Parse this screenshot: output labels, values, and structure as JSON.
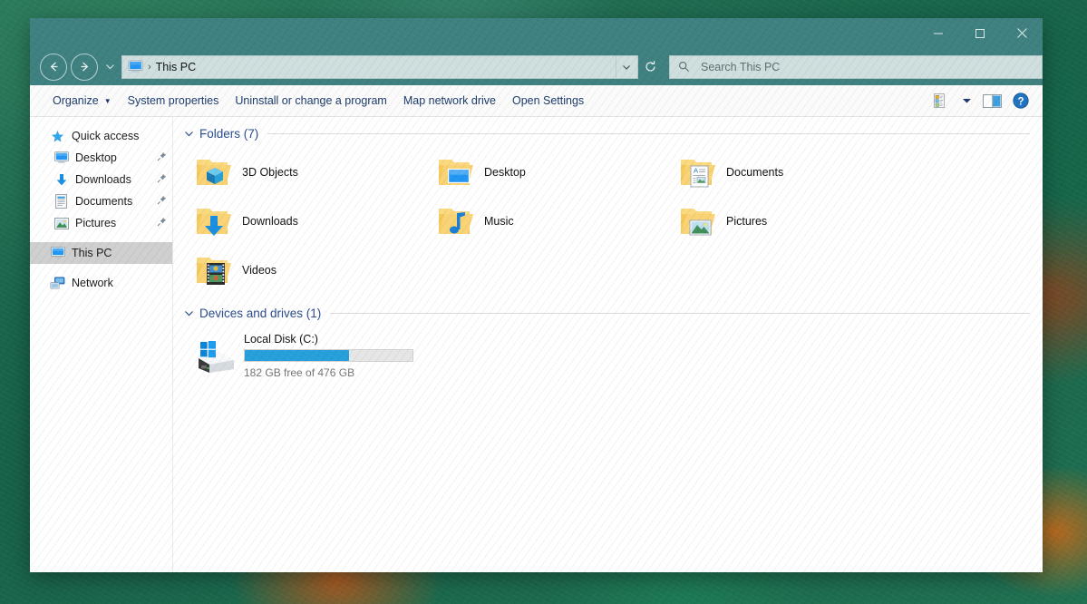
{
  "window": {
    "titlebar_color": "#3f8080",
    "controls": [
      {
        "name": "minimize",
        "glyph": "minimize-icon"
      },
      {
        "name": "maximize",
        "glyph": "maximize-icon"
      },
      {
        "name": "close",
        "glyph": "close-icon"
      }
    ]
  },
  "navigation": {
    "back_label": "Back",
    "forward_label": "Forward",
    "recent_label": "Recent locations",
    "refresh_label": "Refresh"
  },
  "address": {
    "icon": "this-pc-icon",
    "separator": "›",
    "path": "This PC",
    "dropdown": "chevron-down-icon"
  },
  "search": {
    "icon": "search-icon",
    "placeholder": "Search This PC"
  },
  "toolbar": {
    "items": [
      {
        "label": "Organize",
        "has_caret": true
      },
      {
        "label": "System properties",
        "has_caret": false
      },
      {
        "label": "Uninstall or change a program",
        "has_caret": false
      },
      {
        "label": "Map network drive",
        "has_caret": false
      },
      {
        "label": "Open Settings",
        "has_caret": false
      }
    ],
    "caret": "▼",
    "view_icon": "view-options-icon",
    "view_caret": "chevron-down-icon",
    "pane_icon": "preview-pane-icon",
    "help_icon": "help-icon"
  },
  "sidebar": {
    "items": [
      {
        "label": "Quick access",
        "icon": "star-icon",
        "pinned": false,
        "selected": false,
        "indent": false
      },
      {
        "label": "Desktop",
        "icon": "desktop-icon",
        "pinned": true,
        "selected": false,
        "indent": true
      },
      {
        "label": "Downloads",
        "icon": "downloads-icon",
        "pinned": true,
        "selected": false,
        "indent": true
      },
      {
        "label": "Documents",
        "icon": "documents-icon",
        "pinned": true,
        "selected": false,
        "indent": true
      },
      {
        "label": "Pictures",
        "icon": "pictures-icon",
        "pinned": true,
        "selected": false,
        "indent": true
      },
      {
        "label": "This PC",
        "icon": "this-pc-icon",
        "pinned": false,
        "selected": true,
        "indent": false
      },
      {
        "label": "Network",
        "icon": "network-icon",
        "pinned": false,
        "selected": false,
        "indent": false
      }
    ],
    "pin_glyph": "pin-icon"
  },
  "content": {
    "folders_group": {
      "title": "Folders (7)",
      "chevron": "chevron-down-icon",
      "items": [
        {
          "label": "3D Objects",
          "icon": "folder-3d-objects-icon"
        },
        {
          "label": "Desktop",
          "icon": "folder-desktop-icon"
        },
        {
          "label": "Documents",
          "icon": "folder-documents-icon"
        },
        {
          "label": "Downloads",
          "icon": "folder-downloads-icon"
        },
        {
          "label": "Music",
          "icon": "folder-music-icon"
        },
        {
          "label": "Pictures",
          "icon": "folder-pictures-icon"
        },
        {
          "label": "Videos",
          "icon": "folder-videos-icon"
        }
      ]
    },
    "devices_group": {
      "title": "Devices and drives (1)",
      "chevron": "chevron-down-icon",
      "drives": [
        {
          "name": "Local Disk (C:)",
          "icon": "windows-drive-icon",
          "free_text": "182 GB free of 476 GB",
          "free_gb": 182,
          "total_gb": 476,
          "used_percent": 62,
          "bar_color": "#26a0da"
        }
      ]
    }
  }
}
